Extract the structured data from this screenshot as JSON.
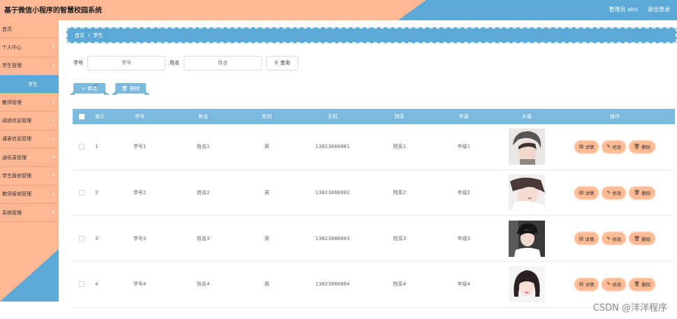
{
  "header": {
    "title": "基于微信小程序的智慧校园系统",
    "user": "管理员 abo",
    "logout": "退出登录"
  },
  "sidebar": {
    "items": [
      {
        "label": "首页",
        "has_children": false
      },
      {
        "label": "个人中心",
        "has_children": true
      },
      {
        "label": "学生管理",
        "has_children": true
      },
      {
        "label": "学生",
        "sub": true
      },
      {
        "label": "教师管理",
        "has_children": true
      },
      {
        "label": "成绩信息管理",
        "has_children": true
      },
      {
        "label": "课表信息管理",
        "has_children": true
      },
      {
        "label": "通讯录管理",
        "has_children": true
      },
      {
        "label": "学生报修管理",
        "has_children": true
      },
      {
        "label": "教师报修管理",
        "has_children": true
      },
      {
        "label": "系统管理",
        "has_children": true
      }
    ]
  },
  "breadcrumb": {
    "home": "首页",
    "separator": "/",
    "current": "学生"
  },
  "search": {
    "no_label": "学号",
    "no_placeholder": "学号",
    "name_label": "姓名",
    "name_placeholder": "姓名",
    "button": "查询"
  },
  "actions": {
    "add": "新增",
    "delete": "删除"
  },
  "table": {
    "headers": {
      "index": "索引",
      "no": "学号",
      "name": "姓名",
      "sex": "性别",
      "phone": "手机",
      "dept": "院系",
      "grade": "年级",
      "avatar": "头像",
      "ops": "操作"
    },
    "rows": [
      {
        "index": "1",
        "no": "学号1",
        "name": "姓名1",
        "sex": "男",
        "phone": "13823888881",
        "dept": "院系1",
        "grade": "年级1"
      },
      {
        "index": "2",
        "no": "学号2",
        "name": "姓名2",
        "sex": "男",
        "phone": "13823888882",
        "dept": "院系2",
        "grade": "年级2"
      },
      {
        "index": "3",
        "no": "学号3",
        "name": "姓名3",
        "sex": "男",
        "phone": "13823888883",
        "dept": "院系3",
        "grade": "年级3"
      },
      {
        "index": "4",
        "no": "学号4",
        "name": "姓名4",
        "sex": "男",
        "phone": "13823888884",
        "dept": "院系4",
        "grade": "年级4"
      }
    ],
    "row_actions": {
      "detail": "详情",
      "edit": "修改",
      "delete": "删除"
    }
  },
  "watermark": "CSDN @洋洋程序",
  "colors": {
    "peach": "#ffb896",
    "blue": "#5aa9d6",
    "table_header": "#7cb9dc",
    "op_button": "#ffbb93"
  }
}
